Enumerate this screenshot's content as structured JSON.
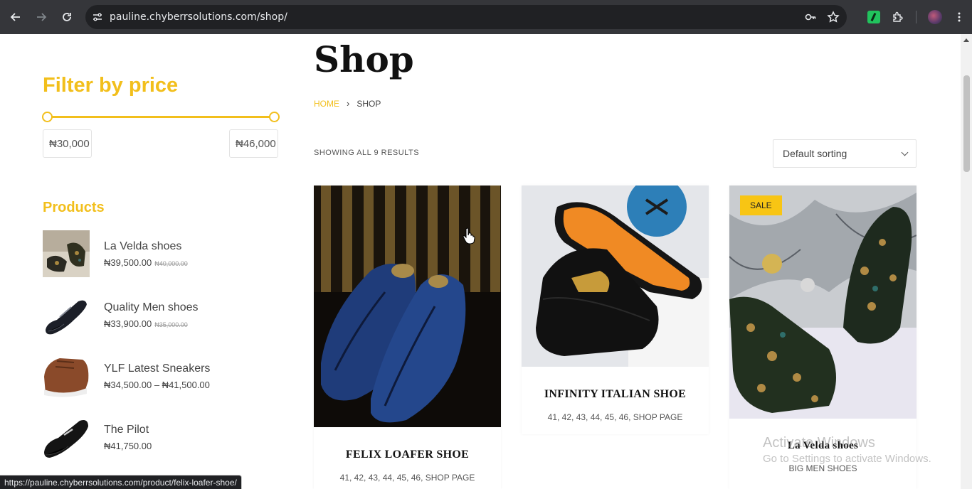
{
  "browser": {
    "url": "pauline.chyberrsolutions.com/shop/",
    "status_url": "https://pauline.chyberrsolutions.com/product/felix-loafer-shoe/"
  },
  "sidebar": {
    "filter_title": "Filter by price",
    "min_price": "₦30,000",
    "max_price": "₦46,000",
    "products_title": "Products",
    "products": [
      {
        "name": "La Velda shoes",
        "price": "₦39,500.00",
        "old_price": "₦40,000.00"
      },
      {
        "name": "Quality Men shoes",
        "price": "₦33,900.00",
        "old_price": "₦35,000.00"
      },
      {
        "name": "YLF Latest Sneakers",
        "price": "₦34,500.00 – ₦41,500.00",
        "old_price": ""
      },
      {
        "name": "The Pilot",
        "price": "₦41,750.00",
        "old_price": ""
      }
    ]
  },
  "main": {
    "title": "Shop",
    "breadcrumb": {
      "home": "HOME",
      "separator": "›",
      "current": "SHOP"
    },
    "result_count": "SHOWING ALL 9 RESULTS",
    "sorting": "Default sorting",
    "cards": [
      {
        "name": "FELIX LOAFER SHOE",
        "meta": "41, 42, 43, 44, 45, 46, SHOP PAGE",
        "badge": ""
      },
      {
        "name": "INFINITY ITALIAN SHOE",
        "meta": "41, 42, 43, 44, 45, 46, SHOP PAGE",
        "badge": ""
      },
      {
        "name": "La Velda shoes",
        "meta": "BIG MEN SHOES",
        "badge": "SALE"
      }
    ]
  },
  "watermark": {
    "line1": "Activate Windows",
    "line2": "Go to Settings to activate Windows."
  },
  "colors": {
    "accent": "#f2bf1c",
    "chrome_bg": "#35363a",
    "sale_badge": "#f8c514"
  }
}
